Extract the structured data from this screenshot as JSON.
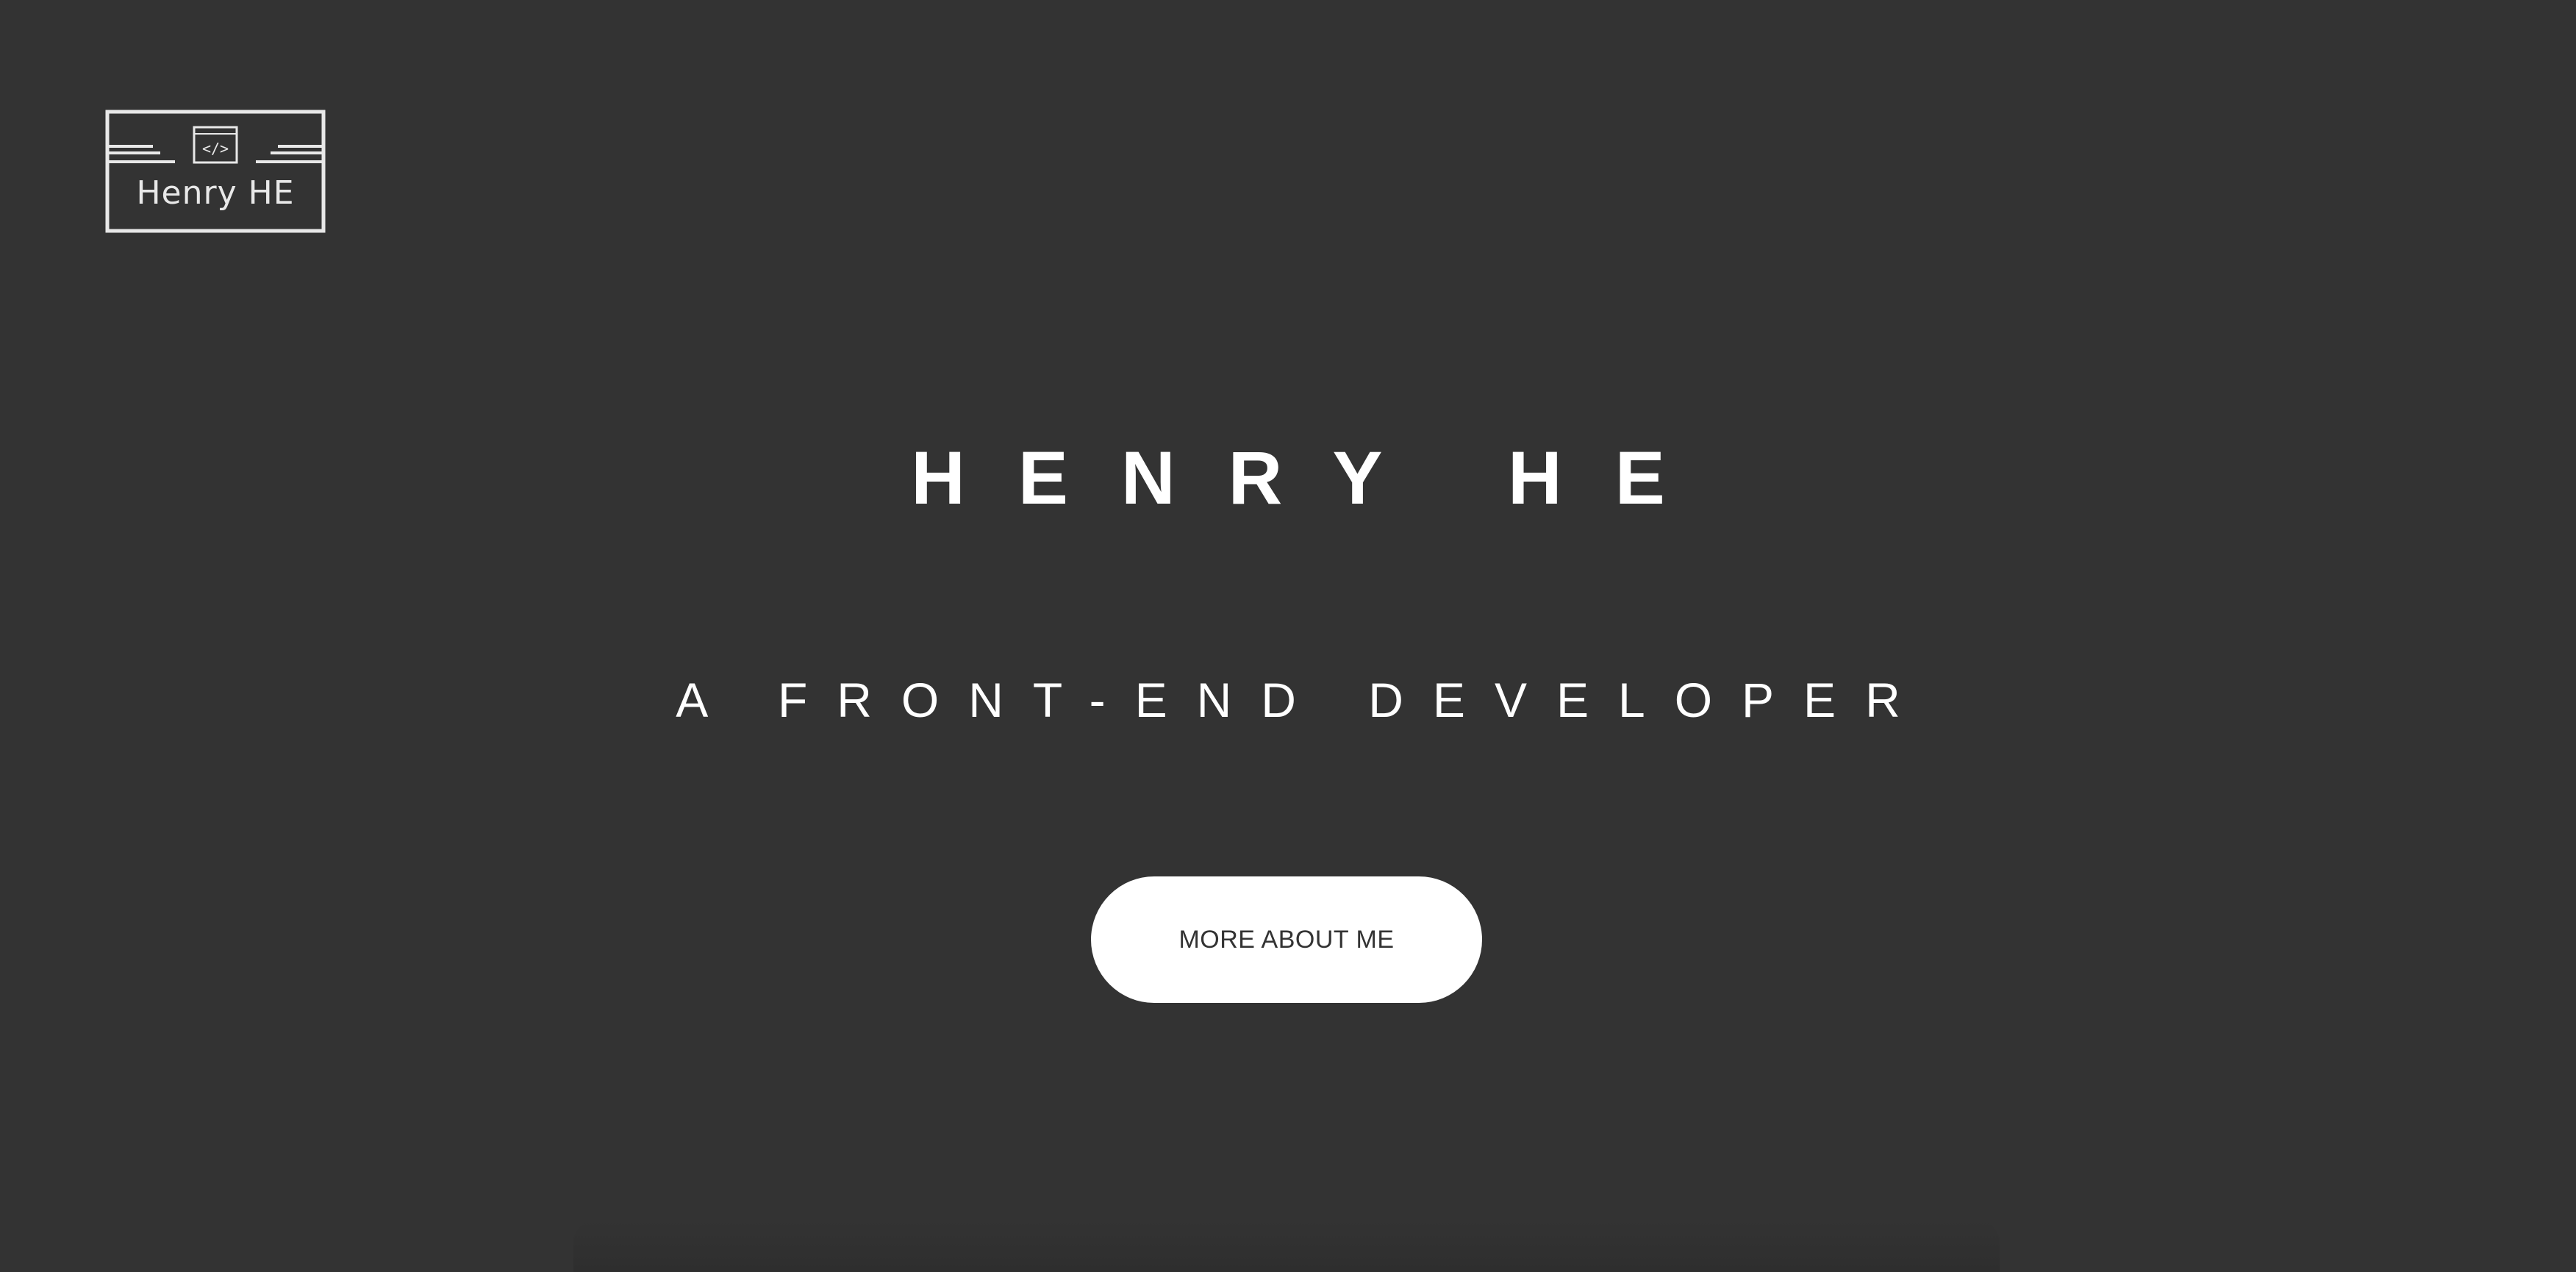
{
  "logo": {
    "text": "Henry HE",
    "code_symbol": "</>",
    "icon": "code-window-icon",
    "color": "#e8e8e8"
  },
  "hero": {
    "title": "HENRY HE",
    "subtitle": "A FRONT-END DEVELOPER",
    "cta_label": "MORE ABOUT ME"
  },
  "colors": {
    "background": "#333333",
    "text": "#ffffff",
    "button_bg": "#ffffff",
    "button_text": "#333333"
  }
}
